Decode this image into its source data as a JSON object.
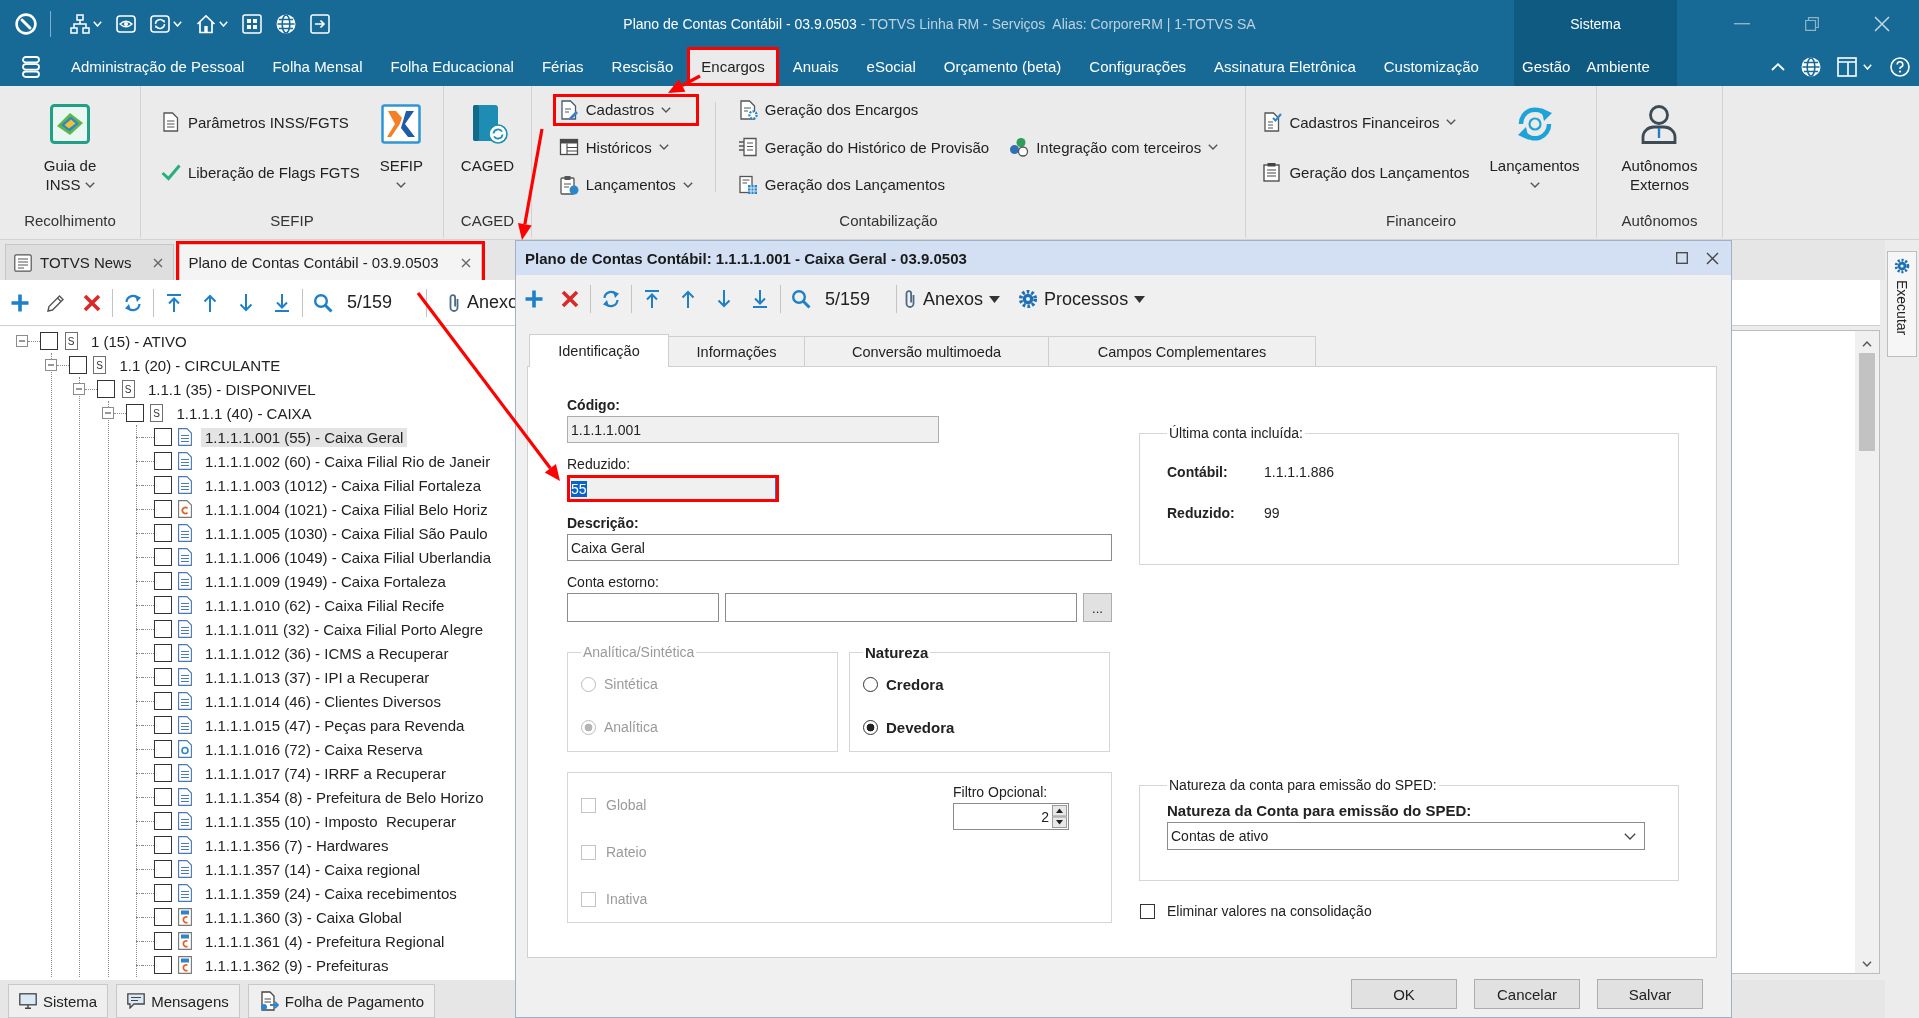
{
  "title_bar": {
    "document_title": "Plano de Contas Contábil - 03.9.0503",
    "app_info": "- TOTVS Linha RM - Serviços  Alias: CorporeRM | 1-TOTVS SA",
    "system_label": "Sistema"
  },
  "menu": {
    "items": [
      {
        "label": "Administração de Pessoal",
        "selected": false,
        "highlighted": false
      },
      {
        "label": "Folha Mensal",
        "selected": false,
        "highlighted": false
      },
      {
        "label": "Folha Educacional",
        "selected": false,
        "highlighted": false
      },
      {
        "label": "Férias",
        "selected": false,
        "highlighted": false
      },
      {
        "label": "Rescisão",
        "selected": false,
        "highlighted": false
      },
      {
        "label": "Encargos",
        "selected": true,
        "highlighted": true
      },
      {
        "label": "Anuais",
        "selected": false,
        "highlighted": false
      },
      {
        "label": "eSocial",
        "selected": false,
        "highlighted": false
      },
      {
        "label": "Orçamento (beta)",
        "selected": false,
        "highlighted": false
      },
      {
        "label": "Configurações",
        "selected": false,
        "highlighted": false
      },
      {
        "label": "Assinatura Eletrônica",
        "selected": false,
        "highlighted": false
      },
      {
        "label": "Customização",
        "selected": false,
        "highlighted": false
      }
    ],
    "system_items": [
      {
        "label": "Gestão",
        "selected": false
      },
      {
        "label": "Ambiente",
        "selected": false
      }
    ]
  },
  "ribbon": {
    "groups": [
      {
        "label": "Recolhimento",
        "items": [
          {
            "kind": "large",
            "label": "Guia de INSS",
            "dropdown": true
          }
        ]
      },
      {
        "label": "SEFIP",
        "items": [
          {
            "kind": "stack",
            "items": [
              {
                "label": "Parâmetros INSS/FGTS",
                "dropdown": false,
                "highlighted": false
              },
              {
                "label": "Liberação de Flags FGTS",
                "dropdown": false,
                "highlighted": false
              }
            ]
          },
          {
            "kind": "large",
            "label": "SEFIP",
            "dropdown": true
          }
        ]
      },
      {
        "label": "CAGED",
        "items": [
          {
            "kind": "large",
            "label": "CAGED",
            "dropdown": false
          }
        ]
      },
      {
        "label": "Contabilização",
        "items": [
          {
            "kind": "stack",
            "items": [
              {
                "label": "Cadastros",
                "dropdown": true,
                "highlighted": true
              },
              {
                "label": "Históricos",
                "dropdown": true,
                "highlighted": false
              },
              {
                "label": "Lançamentos",
                "dropdown": true,
                "highlighted": false
              }
            ]
          },
          {
            "kind": "separator"
          },
          {
            "kind": "stack",
            "items": [
              {
                "label": "Geração dos Encargos",
                "dropdown": false,
                "highlighted": false
              },
              {
                "label": "Geração do Histórico de Provisão",
                "dropdown": false,
                "highlighted": false
              },
              {
                "label": "Geração dos Lançamentos",
                "dropdown": false,
                "highlighted": false
              }
            ]
          },
          {
            "kind": "stack",
            "items": [
              {
                "label": "Integração com terceiros",
                "dropdown": true,
                "highlighted": false
              }
            ]
          }
        ]
      },
      {
        "label": "Financeiro",
        "items": [
          {
            "kind": "stack",
            "items": [
              {
                "label": "Cadastros Financeiros",
                "dropdown": true,
                "highlighted": false
              },
              {
                "label": "Geração dos Lançamentos",
                "dropdown": false,
                "highlighted": false
              }
            ]
          },
          {
            "kind": "large",
            "label": "Lançamentos",
            "dropdown": true
          }
        ]
      },
      {
        "label": "Autônomos",
        "items": [
          {
            "kind": "large",
            "label": "Autônomos Externos",
            "dropdown": false
          }
        ]
      }
    ]
  },
  "document_tabs": [
    {
      "label": "TOTVS News",
      "selected": false,
      "highlighted": false
    },
    {
      "label": "Plano de Contas Contábil - 03.9.0503",
      "selected": true,
      "highlighted": true
    }
  ],
  "record_toolbar": {
    "position": "5/159",
    "attachments_label": "Anexo"
  },
  "account_tree": [
    {
      "label": "1 (15) - ATIVO",
      "kind": "summary",
      "mark": "S",
      "checked": false,
      "selected": false,
      "expanded": true,
      "children": [
        {
          "label": "1.1 (20) - CIRCULANTE",
          "kind": "summary",
          "mark": "S",
          "checked": false,
          "selected": false,
          "expanded": true,
          "children": [
            {
              "label": "1.1.1 (35) - DISPONIVEL",
              "kind": "summary",
              "mark": "S",
              "checked": false,
              "selected": false,
              "expanded": true,
              "children": [
                {
                  "label": "1.1.1.1 (40) - CAIXA",
                  "kind": "summary",
                  "mark": "S",
                  "checked": false,
                  "selected": false,
                  "expanded": true,
                  "children": [
                    {
                      "label": "1.1.1.1.001 (55) - Caixa Geral",
                      "kind": "document",
                      "checked": false,
                      "selected": true
                    },
                    {
                      "label": "1.1.1.1.002 (60) - Caixa Filial Rio de Janeir",
                      "kind": "document",
                      "checked": false,
                      "selected": false
                    },
                    {
                      "label": "1.1.1.1.003 (1012) - Caixa Filial Fortaleza",
                      "kind": "document",
                      "checked": false,
                      "selected": false
                    },
                    {
                      "label": "1.1.1.1.004 (1021) - Caixa Filial Belo Horiz",
                      "kind": "tagged",
                      "checked": false,
                      "selected": false
                    },
                    {
                      "label": "1.1.1.1.005 (1030) - Caixa Filial São Paulo",
                      "kind": "document",
                      "checked": false,
                      "selected": false
                    },
                    {
                      "label": "1.1.1.1.006 (1049) - Caixa Filial Uberlandia",
                      "kind": "document",
                      "checked": false,
                      "selected": false
                    },
                    {
                      "label": "1.1.1.1.009 (1949) - Caixa Fortaleza",
                      "kind": "document",
                      "checked": false,
                      "selected": false
                    },
                    {
                      "label": "1.1.1.1.010 (62) - Caixa Filial Recife",
                      "kind": "document",
                      "checked": false,
                      "selected": false
                    },
                    {
                      "label": "1.1.1.1.011 (32) - Caixa Filial Porto Alegre",
                      "kind": "document",
                      "checked": false,
                      "selected": false
                    },
                    {
                      "label": "1.1.1.1.012 (36) - ICMS a Recuperar",
                      "kind": "document",
                      "checked": false,
                      "selected": false
                    },
                    {
                      "label": "1.1.1.1.013 (37) - IPI a Recuperar",
                      "kind": "document",
                      "checked": false,
                      "selected": false
                    },
                    {
                      "label": "1.1.1.1.014 (46) - Clientes Diversos",
                      "kind": "document",
                      "checked": false,
                      "selected": false
                    },
                    {
                      "label": "1.1.1.1.015 (47) - Peças para Revenda",
                      "kind": "document",
                      "checked": false,
                      "selected": false
                    },
                    {
                      "label": "1.1.1.1.016 (72) - Caixa Reserva",
                      "kind": "linked",
                      "checked": false,
                      "selected": false
                    },
                    {
                      "label": "1.1.1.1.017 (74) - IRRF a Recuperar",
                      "kind": "document",
                      "checked": false,
                      "selected": false
                    },
                    {
                      "label": "1.1.1.1.354 (8) - Prefeitura de Belo Horizo",
                      "kind": "document",
                      "checked": false,
                      "selected": false
                    },
                    {
                      "label": "1.1.1.1.355 (10) - Imposto  Recuperar",
                      "kind": "document",
                      "checked": false,
                      "selected": false
                    },
                    {
                      "label": "1.1.1.1.356 (7) - Hardwares",
                      "kind": "document",
                      "checked": false,
                      "selected": false
                    },
                    {
                      "label": "1.1.1.1.357 (14) - Caixa regional",
                      "kind": "document",
                      "checked": false,
                      "selected": false
                    },
                    {
                      "label": "1.1.1.1.359 (24) - Caixa recebimentos",
                      "kind": "document",
                      "checked": false,
                      "selected": false
                    },
                    {
                      "label": "1.1.1.1.360 (3) - Caixa Global",
                      "kind": "grouped",
                      "checked": false,
                      "selected": false
                    },
                    {
                      "label": "1.1.1.1.361 (4) - Prefeitura Regional",
                      "kind": "grouped",
                      "checked": false,
                      "selected": false
                    },
                    {
                      "label": "1.1.1.1.362 (9) - Prefeituras",
                      "kind": "grouped",
                      "checked": false,
                      "selected": false
                    }
                  ]
                }
              ]
            }
          ]
        }
      ]
    }
  ],
  "bottom_tabs": [
    "Sistema",
    "Mensagens",
    "Folha de Pagamento"
  ],
  "side_panel": {
    "label": "Executar"
  },
  "dialog": {
    "title": "Plano de Contas Contábil: 1.1.1.1.001 - Caixa Geral - 03.9.0503",
    "toolbar": {
      "position": "5/159",
      "attachments_label": "Anexos",
      "processes_label": "Processos"
    },
    "tabs": [
      {
        "label": "Identificação",
        "selected": true
      },
      {
        "label": "Informações",
        "selected": false
      },
      {
        "label": "Conversão multimoeda",
        "selected": false
      },
      {
        "label": "Campos Complementares",
        "selected": false
      }
    ],
    "code_field": {
      "label": "Código:",
      "value": "1.1.1.1.001",
      "required": true,
      "readonly": true,
      "focused": false,
      "highlighted": false
    },
    "short_code_field": {
      "label": "Reduzido:",
      "value": "55",
      "required": false,
      "readonly": true,
      "focused": true,
      "highlighted": true
    },
    "description_field": {
      "label": "Descrição:",
      "value": "Caixa Geral",
      "required": true,
      "readonly": false,
      "focused": false,
      "highlighted": false
    },
    "reversal_account": {
      "label": "Conta estorno:",
      "browse_label": "..."
    },
    "account_type": {
      "title": "Analítica/Sintética",
      "required": false,
      "disabled": true,
      "options": [
        {
          "label": "Sintética",
          "selected": false
        },
        {
          "label": "Analítica",
          "selected": true
        }
      ]
    },
    "nature": {
      "title": "Natureza",
      "required": true,
      "disabled": false,
      "options": [
        {
          "label": "Credora",
          "selected": false
        },
        {
          "label": "Devedora",
          "selected": true
        }
      ]
    },
    "flags": {
      "disabled": true,
      "items": [
        {
          "label": "Global",
          "checked": false
        },
        {
          "label": "Rateio",
          "checked": false
        },
        {
          "label": "Inativa",
          "checked": false
        }
      ]
    },
    "optional_filter": {
      "label": "Filtro Opcional:",
      "value": "2"
    },
    "last_account": {
      "title": "Última conta incluída:",
      "rows": [
        {
          "label": "Contábil:",
          "value": "1.1.1.1.886"
        },
        {
          "label": "Reduzido:",
          "value": "99"
        }
      ]
    },
    "sped": {
      "title": "Natureza da conta para emissão do SPED:",
      "field_label": "Natureza da Conta para emissão do SPED:",
      "value": "Contas de ativo"
    },
    "consolidation_checkbox": {
      "label": "Eliminar valores na consolidação",
      "checked": false
    },
    "buttons": [
      "OK",
      "Cancelar",
      "Salvar"
    ]
  }
}
